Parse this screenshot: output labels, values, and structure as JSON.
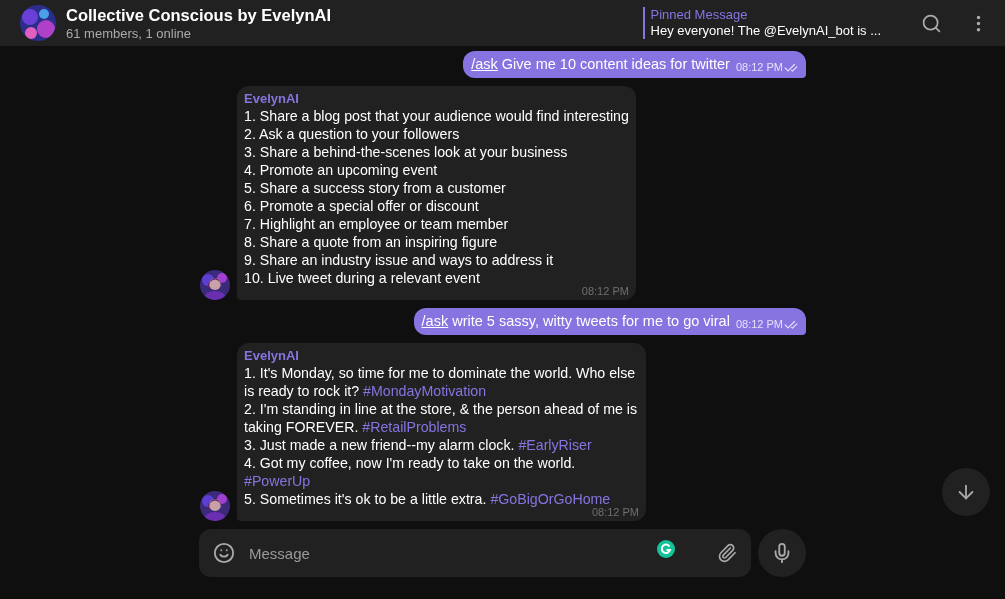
{
  "header": {
    "title": "Collective Conscious by EvelynAI",
    "subtitle": "61 members, 1 online",
    "pinned": {
      "label": "Pinned Message",
      "text": "Hey everyone! The @EvelynAI_bot is ..."
    }
  },
  "messages": [
    {
      "kind": "outgoing",
      "command": "/ask",
      "text": "Give me 10 content ideas for twitter",
      "time": "08:12 PM",
      "read": true
    },
    {
      "kind": "incoming",
      "sender": "EvelynAI",
      "time": "08:12 PM",
      "lines": [
        {
          "text": "1. Share a blog post that your audience would find interesting"
        },
        {
          "text": "2. Ask a question to your followers"
        },
        {
          "text": "3. Share a behind-the-scenes look at your business"
        },
        {
          "text": "4. Promote an upcoming event"
        },
        {
          "text": "5. Share a success story from a customer"
        },
        {
          "text": "6. Promote a special offer or discount"
        },
        {
          "text": "7. Highlight an employee or team member"
        },
        {
          "text": "8. Share a quote from an inspiring figure"
        },
        {
          "text": "9. Share an industry issue and ways to address it"
        },
        {
          "text": "10. Live tweet during a relevant event"
        }
      ]
    },
    {
      "kind": "outgoing",
      "command": "/ask",
      "text": "write 5 sassy, witty tweets for me to go viral",
      "time": "08:12 PM",
      "read": true
    },
    {
      "kind": "incoming",
      "sender": "EvelynAI",
      "time": "08:12 PM",
      "lines": [
        {
          "text": "1. It's Monday, so time for me to dominate the world. Who else is ready to rock it?",
          "tag": "#MondayMotivation"
        },
        {
          "text": "2. I'm standing in line at the store, & the person ahead of me is taking FOREVER.",
          "tag": "#RetailProblems"
        },
        {
          "text": "3. Just made a new friend--my alarm clock.",
          "tag": "#EarlyRiser"
        },
        {
          "text": "4. Got my coffee, now I'm ready to take on the world.",
          "tag": "#PowerUp"
        },
        {
          "text": "5. Sometimes it's ok to be a little extra.",
          "tag": "#GoBigOrGoHome"
        }
      ]
    }
  ],
  "composer": {
    "placeholder": "Message"
  }
}
